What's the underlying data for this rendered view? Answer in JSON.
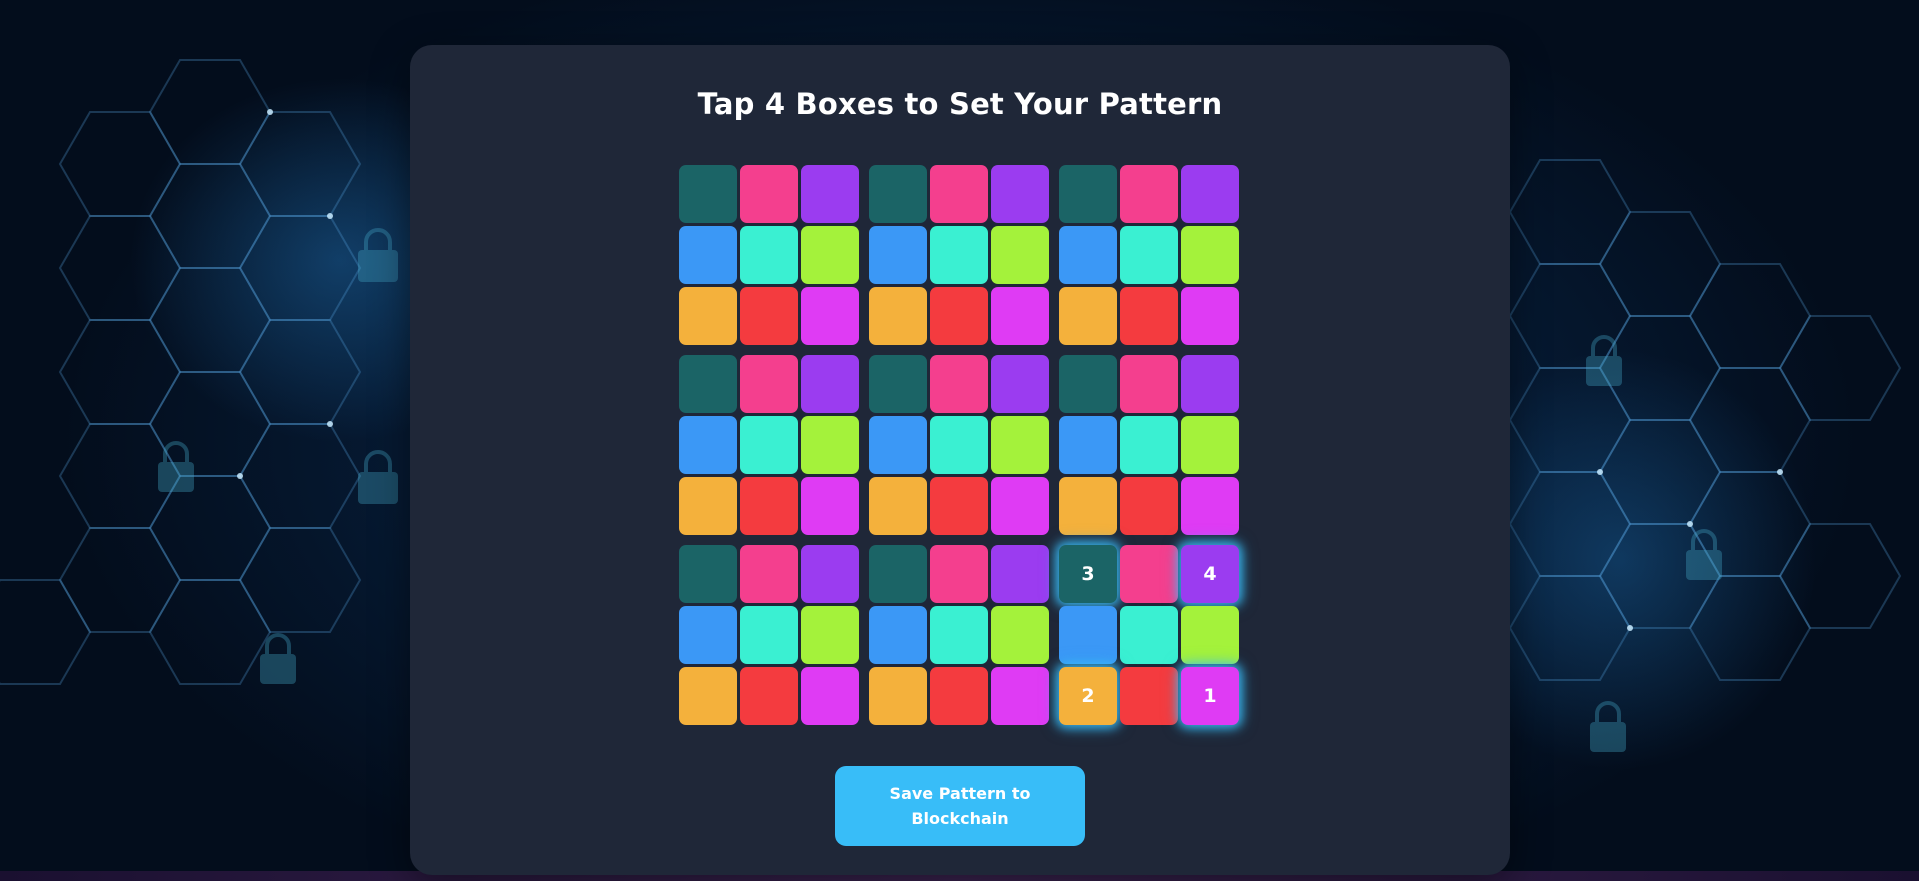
{
  "page": {
    "title": "Tap 4 Boxes to Set Your Pattern",
    "save_button_label": "Save Pattern to Blockchain"
  },
  "colors": {
    "teal_dark": "#1b6466",
    "pink": "#f43f8e",
    "purple": "#9b3cf0",
    "blue": "#3b98f6",
    "aqua": "#3af0d2",
    "lime": "#a4f23b",
    "orange": "#f4b13c",
    "red": "#f43b3f",
    "magenta": "#df3bf4",
    "card": "#1f2738",
    "accent": "#38bdf8"
  },
  "grid": {
    "block_rows": 3,
    "block_cols": 3,
    "block_palette": [
      [
        "teal_dark",
        "pink",
        "purple"
      ],
      [
        "blue",
        "aqua",
        "lime"
      ],
      [
        "orange",
        "red",
        "magenta"
      ]
    ],
    "selections": [
      {
        "order": "1",
        "block_row": 2,
        "block_col": 2,
        "row": 2,
        "col": 2
      },
      {
        "order": "2",
        "block_row": 2,
        "block_col": 2,
        "row": 2,
        "col": 0
      },
      {
        "order": "3",
        "block_row": 2,
        "block_col": 2,
        "row": 0,
        "col": 0
      },
      {
        "order": "4",
        "block_row": 2,
        "block_col": 2,
        "row": 0,
        "col": 2
      }
    ]
  }
}
